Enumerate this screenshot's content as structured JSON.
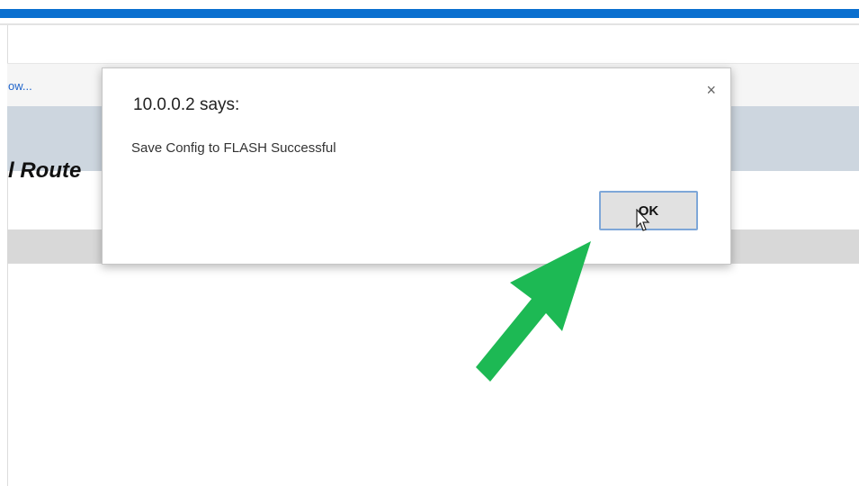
{
  "page": {
    "link_text": "ow...",
    "title_fragment": "l Route"
  },
  "dialog": {
    "title": "10.0.0.2 says:",
    "message": "Save Config to FLASH Successful",
    "ok_label": "OK",
    "close_glyph": "×"
  },
  "colors": {
    "accent_bar": "#0a6fcf",
    "arrow": "#1db954"
  },
  "icons": [
    "close-icon",
    "mouse-cursor-icon",
    "green-arrow-icon"
  ]
}
